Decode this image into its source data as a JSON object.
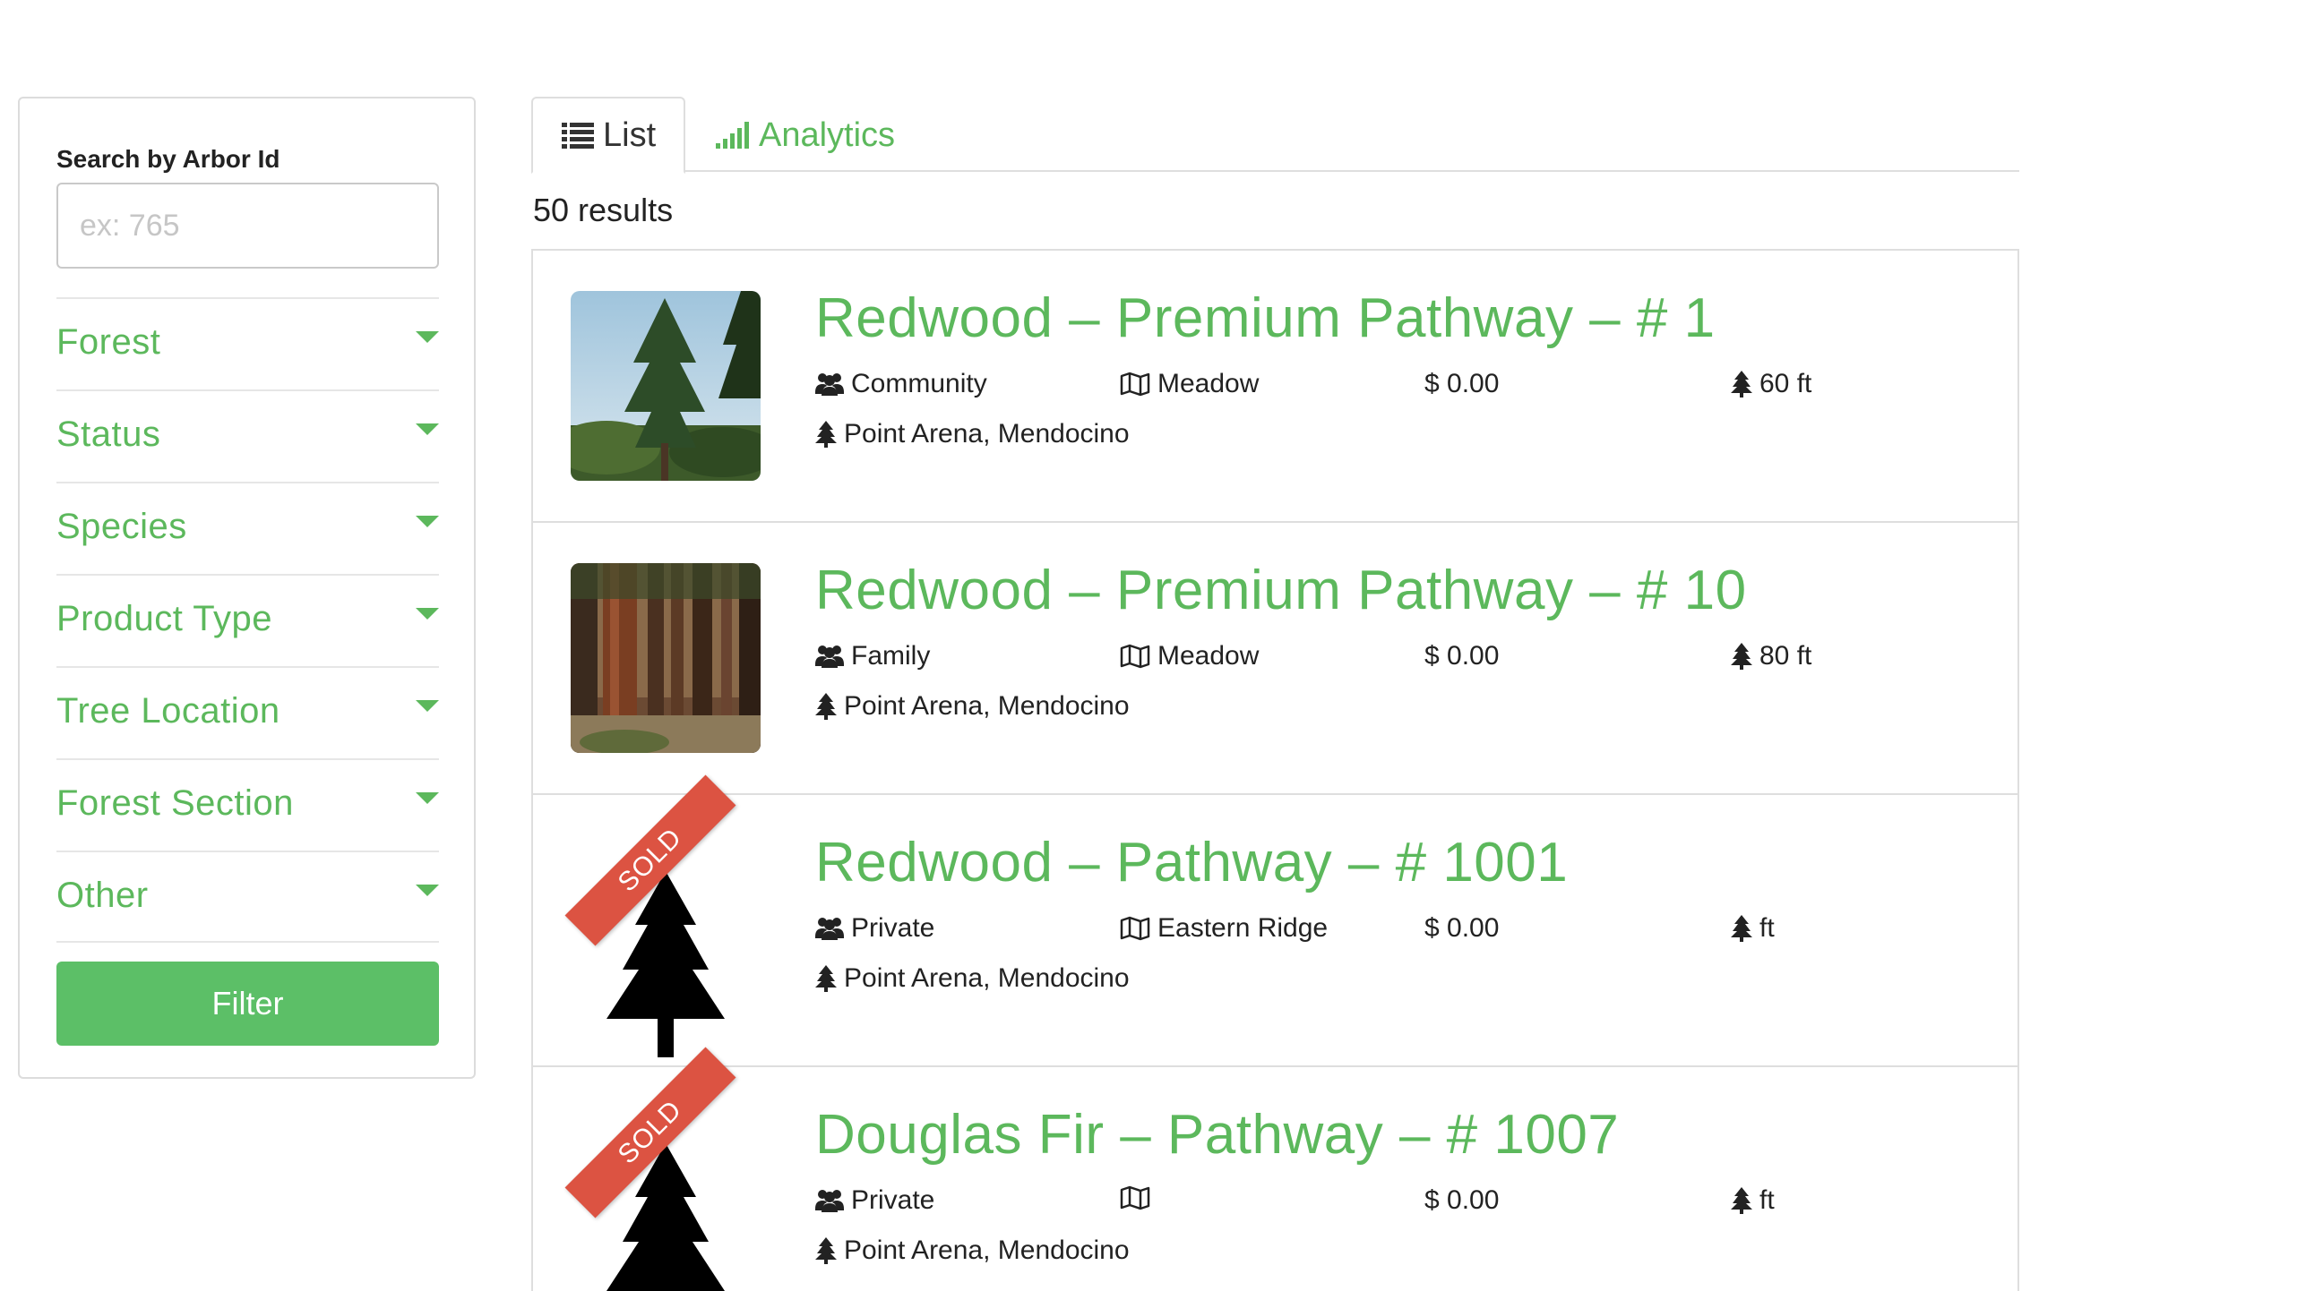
{
  "sidebar": {
    "search_label": "Search by Arbor Id",
    "search_placeholder": "ex: 765",
    "search_value": "",
    "filters": [
      {
        "label": "Forest"
      },
      {
        "label": "Status"
      },
      {
        "label": "Species"
      },
      {
        "label": "Product Type"
      },
      {
        "label": "Tree Location"
      },
      {
        "label": "Forest Section"
      },
      {
        "label": "Other"
      }
    ],
    "filter_button": "Filter"
  },
  "tabs": {
    "list": "List",
    "analytics": "Analytics",
    "active": "List"
  },
  "results_count": "50 results",
  "results": [
    {
      "title": "Redwood – Premium Pathway – # 1",
      "owner": "Community",
      "area": "Meadow",
      "price": "$ 0.00",
      "height": "60 ft",
      "location": "Point Arena, Mendocino",
      "sold": false,
      "image": "sunny-tree-photo"
    },
    {
      "title": "Redwood – Premium Pathway – # 10",
      "owner": "Family",
      "area": "Meadow",
      "price": "$ 0.00",
      "height": "80 ft",
      "location": "Point Arena, Mendocino",
      "sold": false,
      "image": "redwood-trunks-photo"
    },
    {
      "title": "Redwood – Pathway – # 1001",
      "owner": "Private",
      "area": "Eastern Ridge",
      "price": "$ 0.00",
      "height": "ft",
      "location": "Point Arena, Mendocino",
      "sold": true,
      "sold_label": "SOLD",
      "image": "tree-silhouette-icon"
    },
    {
      "title": "Douglas Fir – Pathway – # 1007",
      "owner": "Private",
      "area": "",
      "price": "$ 0.00",
      "height": "ft",
      "location": "Point Arena, Mendocino",
      "sold": true,
      "sold_label": "SOLD",
      "image": "tree-silhouette-icon"
    }
  ],
  "colors": {
    "accent_green": "#5cb85c",
    "button_green": "#5cbf67",
    "sold_red": "#dc5342",
    "border": "#dedede"
  }
}
